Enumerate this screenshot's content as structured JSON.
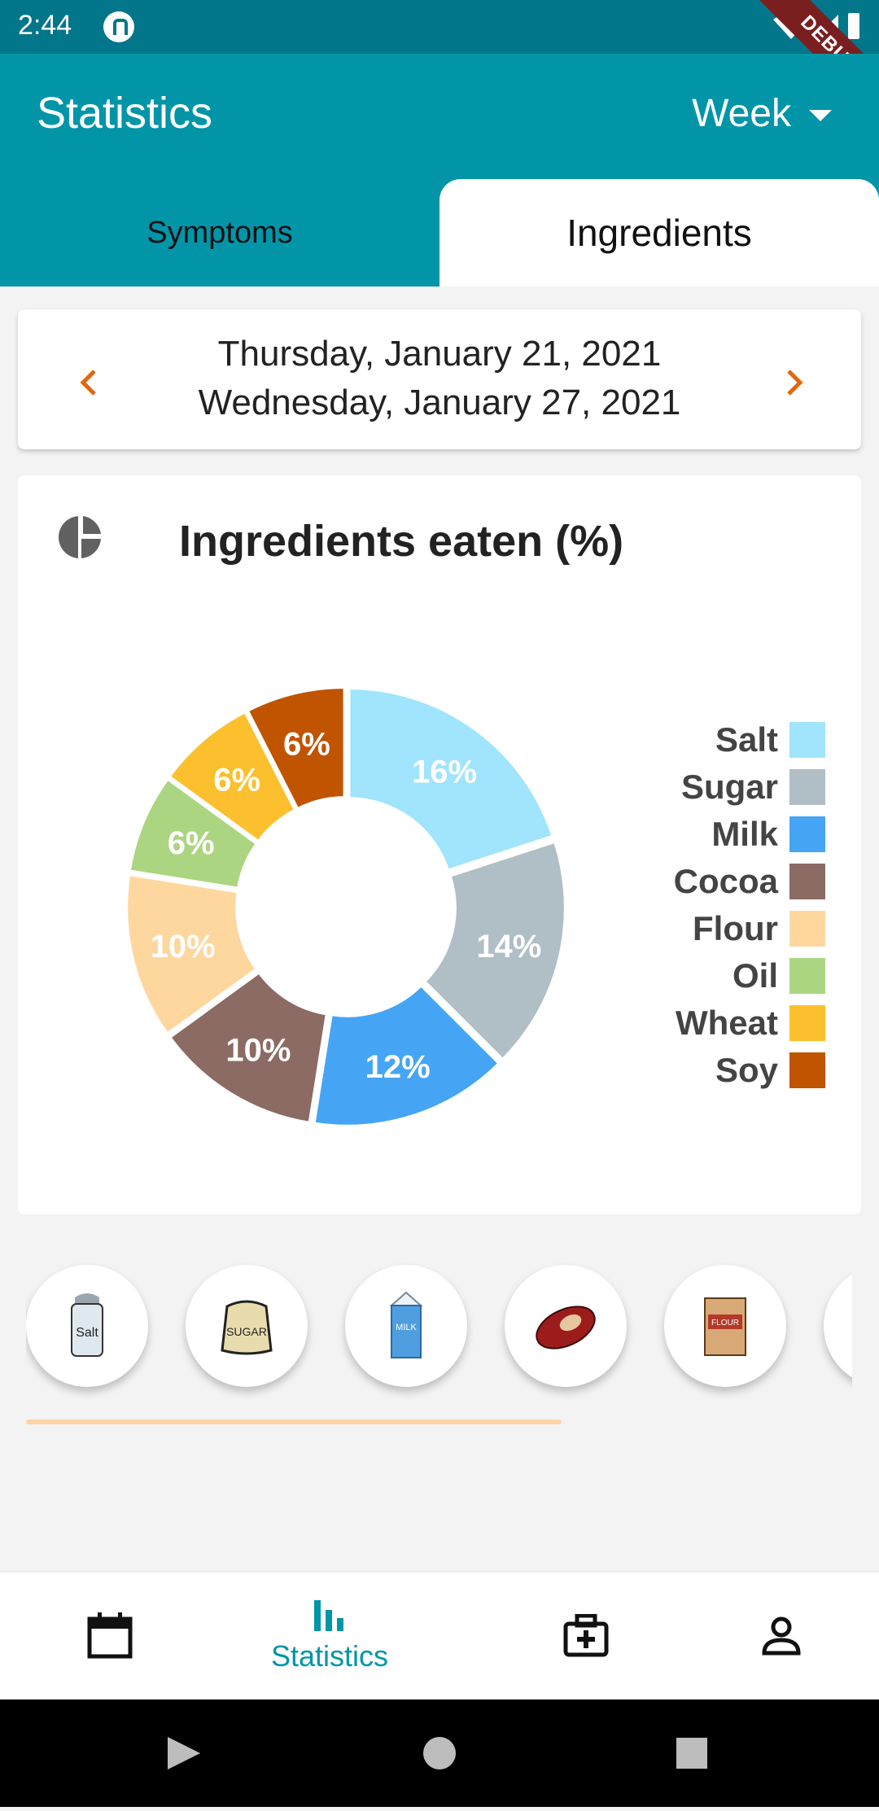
{
  "status_bar": {
    "time": "2:44",
    "debug_label": "DEBUG"
  },
  "app_bar": {
    "title": "Statistics",
    "period": "Week",
    "tabs": [
      {
        "label": "Symptoms",
        "selected": false
      },
      {
        "label": "Ingredients",
        "selected": true
      }
    ]
  },
  "date_range": {
    "start": "Thursday, January 21, 2021",
    "end": "Wednesday, January 27, 2021"
  },
  "chart_card": {
    "title": "Ingredients eaten (%)",
    "icon": "pie-chart-icon"
  },
  "chart_data": {
    "type": "pie",
    "title": "Ingredients eaten (%)",
    "legend": "right",
    "slices": [
      {
        "name": "Salt",
        "value": 16,
        "label": "16%",
        "color": "#a0e4fd"
      },
      {
        "name": "Sugar",
        "value": 14,
        "label": "14%",
        "color": "#b0bec5"
      },
      {
        "name": "Milk",
        "value": 12,
        "label": "12%",
        "color": "#45a5f4"
      },
      {
        "name": "Cocoa",
        "value": 10,
        "label": "10%",
        "color": "#8b6b63"
      },
      {
        "name": "Flour",
        "value": 10,
        "label": "10%",
        "color": "#fed79f"
      },
      {
        "name": "Oil",
        "value": 6,
        "label": "6%",
        "color": "#acd581"
      },
      {
        "name": "Wheat",
        "value": 6,
        "label": "6%",
        "color": "#fcc02e"
      },
      {
        "name": "Soy",
        "value": 6,
        "label": "6%",
        "color": "#c05401"
      }
    ]
  },
  "carousel": {
    "items": [
      {
        "name": "salt",
        "icon": "salt-shaker-icon",
        "text": "Salt"
      },
      {
        "name": "sugar",
        "icon": "sugar-sack-icon",
        "text": "SUGAR"
      },
      {
        "name": "milk",
        "icon": "milk-carton-icon",
        "text": "MILK"
      },
      {
        "name": "cocoa",
        "icon": "cocoa-pod-icon"
      },
      {
        "name": "flour",
        "icon": "flour-bag-icon",
        "text": "FLOUR"
      },
      {
        "name": "oil",
        "icon": "oil-icon"
      }
    ]
  },
  "bottom_nav": {
    "items": [
      {
        "name": "calendar",
        "icon": "calendar-icon",
        "label": ""
      },
      {
        "name": "statistics",
        "icon": "bar-chart-icon",
        "label": "Statistics",
        "active": true
      },
      {
        "name": "medical",
        "icon": "medical-kit-icon",
        "label": ""
      },
      {
        "name": "profile",
        "icon": "person-icon",
        "label": ""
      }
    ]
  },
  "colors": {
    "primary": "#0295a8",
    "status_bar": "#02768a",
    "accent_arrow": "#e0680e"
  }
}
